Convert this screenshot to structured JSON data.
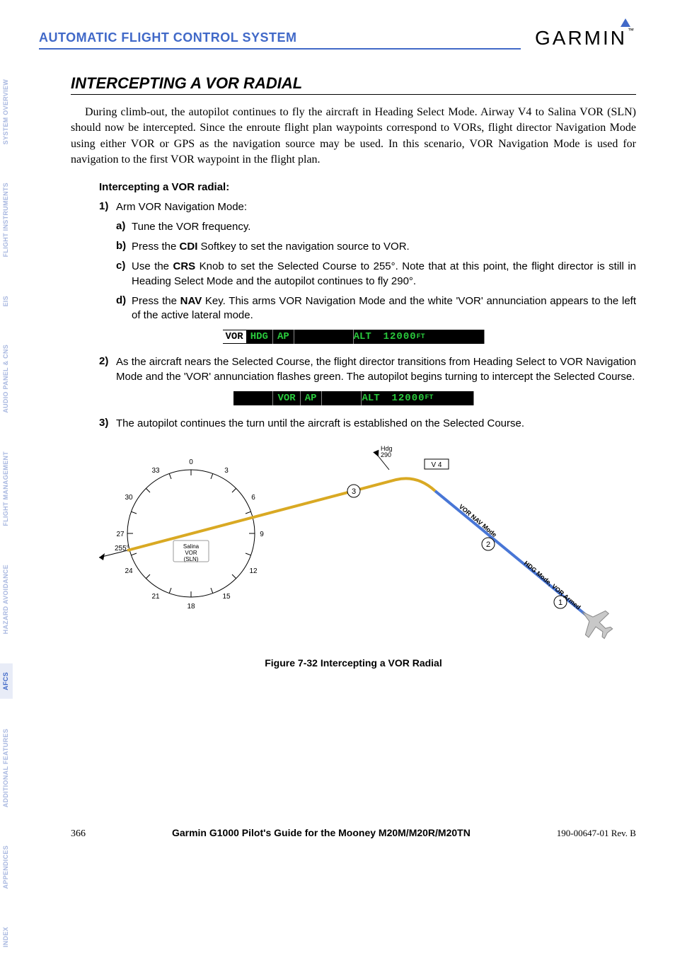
{
  "header": {
    "section_title": "AUTOMATIC FLIGHT CONTROL SYSTEM",
    "logo_text": "GARMIN",
    "logo_tm": "™"
  },
  "sidebar": {
    "tabs": [
      {
        "label": "SYSTEM OVERVIEW",
        "active": false
      },
      {
        "label": "FLIGHT INSTRUMENTS",
        "active": false
      },
      {
        "label": "EIS",
        "active": false
      },
      {
        "label": "AUDIO PANEL & CNS",
        "active": false
      },
      {
        "label": "FLIGHT MANAGEMENT",
        "active": false
      },
      {
        "label": "HAZARD AVOIDANCE",
        "active": false
      },
      {
        "label": "AFCS",
        "active": true
      },
      {
        "label": "ADDITIONAL FEATURES",
        "active": false
      },
      {
        "label": "APPENDICES",
        "active": false
      },
      {
        "label": "INDEX",
        "active": false
      }
    ]
  },
  "content": {
    "h2": "INTERCEPTING A VOR RADIAL",
    "para1": "During climb-out, the autopilot continues to fly the aircraft in Heading Select Mode.  Airway V4 to Salina VOR (SLN) should now be intercepted.  Since the enroute flight plan waypoints correspond to VORs, flight director Navigation Mode using either VOR or GPS as the navigation source may be used.  In this scenario, VOR Navigation Mode is used for navigation to the first VOR waypoint in the flight plan.",
    "subhead": "Intercepting a VOR radial:",
    "step1_num": "1)",
    "step1_txt": "Arm VOR Navigation Mode:",
    "step1a_num": "a)",
    "step1a_txt": "Tune the VOR frequency.",
    "step1b_num": "b)",
    "step1b_pre": "Press the ",
    "step1b_bold": "CDI",
    "step1b_post": " Softkey to set the navigation source to VOR.",
    "step1c_num": "c)",
    "step1c_pre": "Use the ",
    "step1c_bold": "CRS",
    "step1c_post": " Knob to set the Selected Course to 255°.  Note that at this point, the flight director is still in Heading Select Mode and the autopilot continues to fly 290°.",
    "step1d_num": "d)",
    "step1d_pre": "Press the ",
    "step1d_bold": "NAV",
    "step1d_post": " Key.  This arms VOR Navigation Mode and the white 'VOR' annunciation appears to the left of the active lateral mode.",
    "annun1": {
      "vor": "VOR",
      "hdg": "HDG",
      "ap": "AP",
      "alt": "ALT",
      "val": "12000",
      "ft": "FT"
    },
    "step2_num": "2)",
    "step2_txt": "As the aircraft nears the Selected Course, the flight director transitions from Heading Select to VOR Navigation Mode and the 'VOR' annunciation flashes green.  The autopilot begins turning to intercept the Selected Course.",
    "annun2": {
      "vor": "VOR",
      "ap": "AP",
      "alt": "ALT",
      "val": "12000",
      "ft": "FT"
    },
    "step3_num": "3)",
    "step3_txt": "The autopilot continues the turn until the aircraft is established on the Selected Course.",
    "figure": {
      "caption": "Figure 7-32  Intercepting a VOR Radial",
      "labels": {
        "course": "255°",
        "vor_name": "Salina VOR (SLN)",
        "airway": "V 4",
        "hdg": "Hdg 290",
        "mode_vor": "VOR NAV Mode",
        "mode_hdg": "HDG Mode, VOR Armed",
        "compass_n": "0",
        "compass_3": "3",
        "compass_6": "6",
        "compass_e": "9",
        "compass_12": "12",
        "compass_15": "15",
        "compass_s": "18",
        "compass_21": "21",
        "compass_24": "24",
        "compass_w": "27",
        "compass_30": "30",
        "compass_33": "33"
      }
    }
  },
  "footer": {
    "page": "366",
    "title": "Garmin G1000 Pilot's Guide for the Mooney M20M/M20R/M20TN",
    "rev": "190-00647-01  Rev. B"
  }
}
